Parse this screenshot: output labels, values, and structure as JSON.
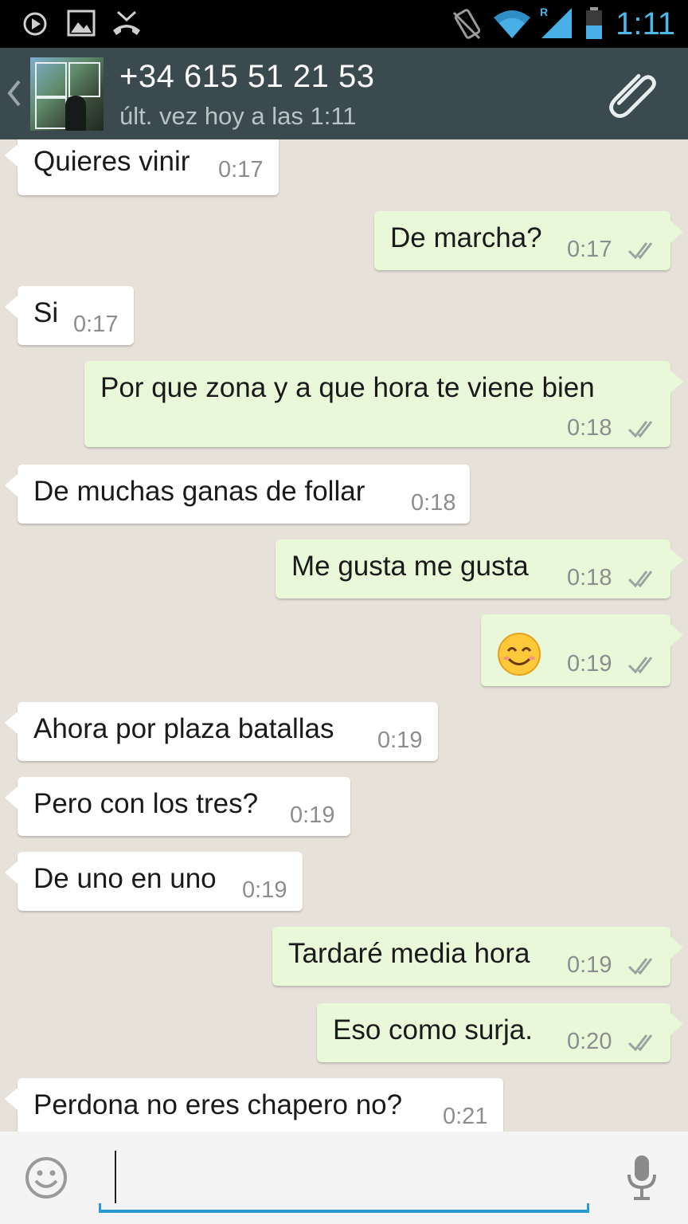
{
  "status_bar": {
    "time": "1:11",
    "icons": [
      "play-circle-icon",
      "image-icon",
      "missed-call-icon",
      "vibrate-icon",
      "wifi-icon",
      "signal-roaming-icon",
      "battery-icon"
    ]
  },
  "header": {
    "contact_name": "+34 615 51 21 53",
    "last_seen": "últ. vez hoy a las 1:11",
    "icons": [
      "back-chevron-icon",
      "avatar",
      "paperclip-icon"
    ]
  },
  "colors": {
    "header_bg": "#3a4a4e",
    "incoming_bubble": "#ffffff",
    "outgoing_bubble": "#e8f8d8",
    "accent": "#2a9ad6",
    "status_time": "#4fb6e8"
  },
  "messages": [
    {
      "dir": "in",
      "text": "Quieres vinir",
      "time": "0:17"
    },
    {
      "dir": "out",
      "text": "De marcha?",
      "time": "0:17"
    },
    {
      "dir": "in",
      "text": "Si",
      "time": "0:17"
    },
    {
      "dir": "out",
      "text": "Por que zona y a que hora te viene bien",
      "time": "0:18"
    },
    {
      "dir": "in",
      "text": "De muchas ganas de follar",
      "time": "0:18"
    },
    {
      "dir": "out",
      "text": "Me gusta me gusta",
      "time": "0:18"
    },
    {
      "dir": "out",
      "text": "😊",
      "time": "0:19"
    },
    {
      "dir": "in",
      "text": "Ahora por plaza batallas",
      "time": "0:19"
    },
    {
      "dir": "in",
      "text": "Pero con los tres?",
      "time": "0:19"
    },
    {
      "dir": "in",
      "text": "De uno en uno",
      "time": "0:19"
    },
    {
      "dir": "out",
      "text": "Tardaré media hora",
      "time": "0:19"
    },
    {
      "dir": "out",
      "text": "Eso como surja.",
      "time": "0:20"
    },
    {
      "dir": "in",
      "text": "Perdona no eres chapero no?",
      "time": "0:21"
    }
  ],
  "input": {
    "value": "",
    "icons": [
      "smiley-icon",
      "microphone-icon"
    ]
  }
}
